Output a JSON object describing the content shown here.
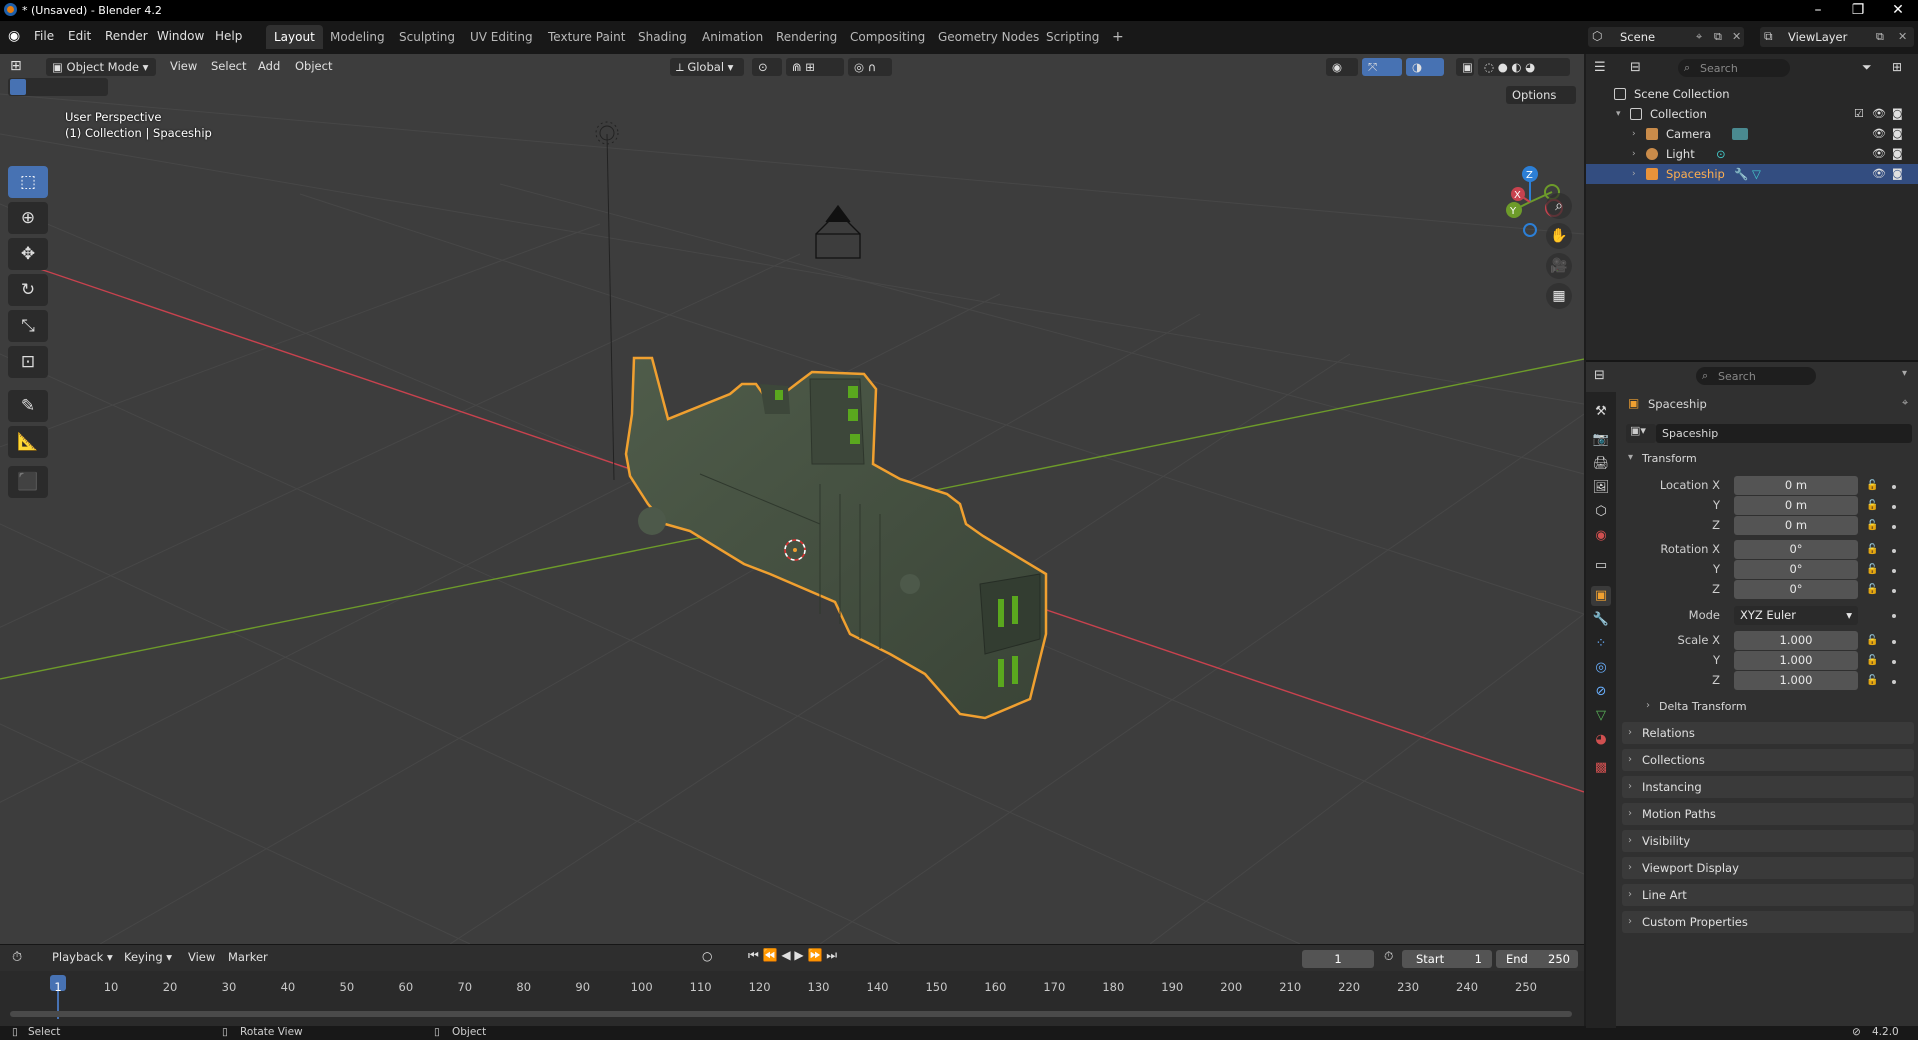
{
  "window": {
    "title": "* (Unsaved) - Blender 4.2",
    "min": "–",
    "max": "❐",
    "close": "✕"
  },
  "menu": [
    "File",
    "Edit",
    "Render",
    "Window",
    "Help"
  ],
  "workspaces": [
    "Layout",
    "Modeling",
    "Sculpting",
    "UV Editing",
    "Texture Paint",
    "Shading",
    "Animation",
    "Rendering",
    "Compositing",
    "Geometry Nodes",
    "Scripting"
  ],
  "workspace_add": "+",
  "active_workspace": "Layout",
  "scene": {
    "name": "Scene",
    "view_layer": "ViewLayer"
  },
  "viewport": {
    "mode": "Object Mode",
    "menus": [
      "View",
      "Select",
      "Add",
      "Object"
    ],
    "transform_orientation": "Global",
    "options": "Options",
    "overlay_line1": "User Perspective",
    "overlay_line2": "(1) Collection | Spaceship",
    "gizmo": {
      "x": "X",
      "y": "Y",
      "z": "Z"
    }
  },
  "timeline": {
    "menus": [
      "Playback",
      "Keying",
      "View",
      "Marker"
    ],
    "current_frame": "1",
    "start_label": "Start",
    "start": "1",
    "end_label": "End",
    "end": "250",
    "ticks": [
      "1",
      "10",
      "20",
      "30",
      "40",
      "50",
      "60",
      "70",
      "80",
      "90",
      "100",
      "110",
      "120",
      "130",
      "140",
      "150",
      "160",
      "170",
      "180",
      "190",
      "200",
      "210",
      "220",
      "230",
      "240",
      "250"
    ]
  },
  "status": {
    "select": "Select",
    "rotate": "Rotate View",
    "object": "Object",
    "version": "4.2.0"
  },
  "outliner": {
    "search_placeholder": "Search",
    "root": "Scene Collection",
    "collection": "Collection",
    "items": [
      "Camera",
      "Light",
      "Spaceship"
    ],
    "selected": "Spaceship"
  },
  "properties": {
    "search_placeholder": "Search",
    "object_name": "Spaceship",
    "datablock": "Spaceship",
    "transform_label": "Transform",
    "location_label": "Location X",
    "rotation_label": "Rotation X",
    "scale_label": "Scale X",
    "y": "Y",
    "z": "Z",
    "location": [
      "0 m",
      "0 m",
      "0 m"
    ],
    "rotation": [
      "0°",
      "0°",
      "0°"
    ],
    "mode_label": "Mode",
    "mode": "XYZ Euler",
    "scale": [
      "1.000",
      "1.000",
      "1.000"
    ],
    "delta_transform": "Delta Transform",
    "panels": [
      "Relations",
      "Collections",
      "Instancing",
      "Motion Paths",
      "Visibility",
      "Viewport Display",
      "Line Art",
      "Custom Properties"
    ]
  },
  "colors": {
    "accent": "#4772b3",
    "selection_outline": "#f0a030",
    "x_axis": "#c8424e",
    "y_axis": "#6d9b2a",
    "z_axis": "#2c7fd6"
  }
}
